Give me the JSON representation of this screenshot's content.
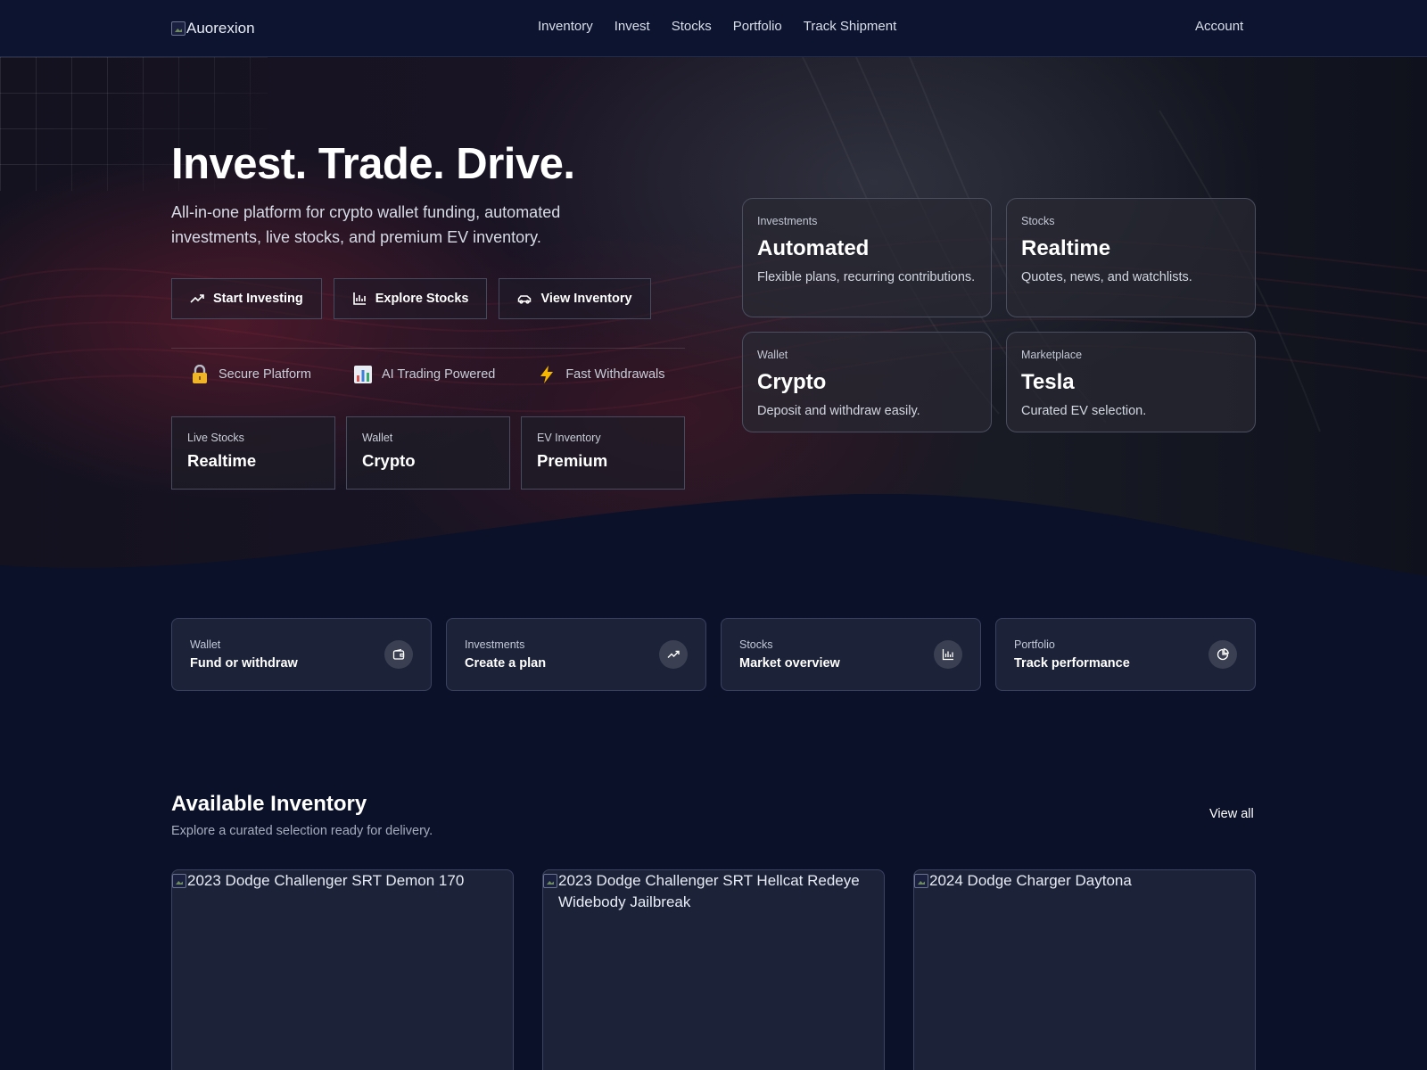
{
  "nav": {
    "brand": "Auorexion",
    "links": [
      "Inventory",
      "Invest",
      "Stocks",
      "Portfolio",
      "Track Shipment"
    ],
    "account": "Account"
  },
  "hero": {
    "title": "Invest. Trade. Drive.",
    "subtitle": "All-in-one platform for crypto wallet funding, automated investments, live stocks, and premium EV inventory.",
    "buttons": [
      {
        "label": "Start Investing",
        "icon": "trending-up-icon"
      },
      {
        "label": "Explore Stocks",
        "icon": "bar-chart-icon"
      },
      {
        "label": "View Inventory",
        "icon": "car-icon"
      }
    ],
    "features": [
      {
        "label": "Secure Platform",
        "icon": "lock-icon"
      },
      {
        "label": "AI Trading Powered",
        "icon": "chart-icon"
      },
      {
        "label": "Fast Withdrawals",
        "icon": "lightning-icon"
      }
    ],
    "mini_stats": [
      {
        "label": "Live Stocks",
        "value": "Realtime"
      },
      {
        "label": "Wallet",
        "value": "Crypto"
      },
      {
        "label": "EV Inventory",
        "value": "Premium"
      }
    ],
    "cards": [
      {
        "label": "Investments",
        "title": "Automated",
        "desc": "Flexible plans, recurring contributions."
      },
      {
        "label": "Stocks",
        "title": "Realtime",
        "desc": "Quotes, news, and watchlists."
      },
      {
        "label": "Wallet",
        "title": "Crypto",
        "desc": "Deposit and withdraw easily."
      },
      {
        "label": "Marketplace",
        "title": "Tesla",
        "desc": "Curated EV selection."
      }
    ]
  },
  "quick_actions": [
    {
      "label": "Wallet",
      "title": "Fund or withdraw",
      "icon": "wallet-icon"
    },
    {
      "label": "Investments",
      "title": "Create a plan",
      "icon": "trending-up-icon"
    },
    {
      "label": "Stocks",
      "title": "Market overview",
      "icon": "bar-chart-icon"
    },
    {
      "label": "Portfolio",
      "title": "Track performance",
      "icon": "pie-chart-icon"
    }
  ],
  "inventory": {
    "title": "Available Inventory",
    "subtitle": "Explore a curated selection ready for delivery.",
    "view_all": "View all",
    "items": [
      {
        "alt": "2023 Dodge Challenger SRT Demon 170"
      },
      {
        "alt": "2023 Dodge Challenger SRT Hellcat Redeye Widebody Jailbreak"
      },
      {
        "alt": "2024 Dodge Charger Daytona"
      }
    ]
  },
  "colors": {
    "page_bg": "#0b1128",
    "nav_bg": "#0d1430",
    "card_bg": "#1c2238",
    "hero_accent": "#7a1e32"
  }
}
